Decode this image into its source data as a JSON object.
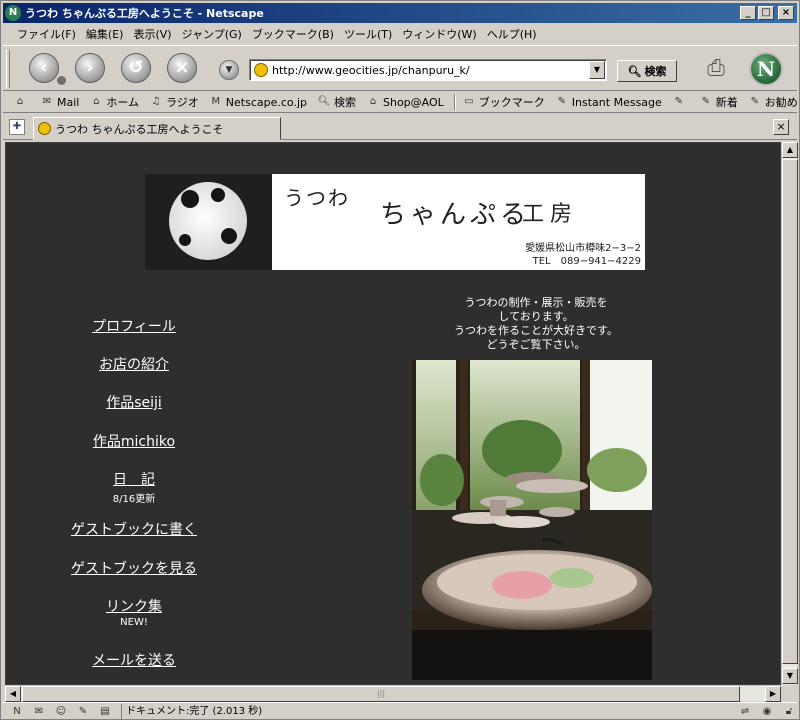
{
  "window": {
    "title": "うつわ ちゃんぷる工房へようこそ - Netscape",
    "controls": {
      "minimize": "_",
      "maximize": "□",
      "close": "×"
    }
  },
  "menu": [
    "ファイル(F)",
    "編集(E)",
    "表示(V)",
    "ジャンプ(G)",
    "ブックマーク(B)",
    "ツール(T)",
    "ウィンドウ(W)",
    "ヘルプ(H)"
  ],
  "toolbar": {
    "url": "http://www.geocities.jp/chanpuru_k/",
    "search_label": "検索"
  },
  "bookmarks": [
    {
      "label": "",
      "icon": "home-menu-icon"
    },
    {
      "label": "Mail",
      "icon": "mail-icon"
    },
    {
      "label": "ホーム",
      "icon": "home-icon"
    },
    {
      "label": "ラジオ",
      "icon": "headphones-icon"
    },
    {
      "label": "Netscape.co.jp",
      "icon": "my-icon"
    },
    {
      "label": "検索",
      "icon": "search-icon"
    },
    {
      "label": "Shop@AOL",
      "icon": "shop-icon"
    },
    {
      "label": "ブックマーク",
      "icon": "folder-icon"
    },
    {
      "label": "Instant Message",
      "icon": "im-icon"
    },
    {
      "label": "",
      "icon": "im-icon"
    },
    {
      "label": "新着",
      "icon": "im-icon"
    },
    {
      "label": "お勧め",
      "icon": "im-icon"
    }
  ],
  "tab": {
    "label": "うつわ ちゃんぷる工房へようこそ"
  },
  "page": {
    "banner": {
      "logo_a": "うつわ",
      "logo_b": "ちゃんぷる",
      "logo_c": "工房",
      "address": "愛媛県松山市樽味2−3−2",
      "tel": "TEL　089−941−4229"
    },
    "nav": [
      {
        "label": "プロフィール",
        "note": ""
      },
      {
        "label": "お店の紹介",
        "note": ""
      },
      {
        "label": "作品seiji",
        "note": ""
      },
      {
        "label": "作品michiko",
        "note": ""
      },
      {
        "label": "日　記",
        "note": "8/16更新"
      },
      {
        "label": "ゲストブックに書く",
        "note": ""
      },
      {
        "label": "ゲストブックを見る",
        "note": ""
      },
      {
        "label": "リンク集",
        "note": "NEW!"
      },
      {
        "label": "メールを送る",
        "note": ""
      }
    ],
    "intro": [
      "うつわの制作・展示・販売を",
      "しております。",
      "うつわを作ることが大好きです。",
      "どうぞご覧下さい。"
    ]
  },
  "status": {
    "text": "ドキュメント:完了 (2.013 秒)"
  }
}
